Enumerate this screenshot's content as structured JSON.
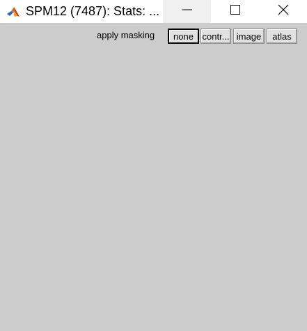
{
  "window": {
    "title": "SPM12 (7487): Stats: ...",
    "icon": "matlab-icon"
  },
  "titlebar_controls": {
    "minimize_icon": "minimize-icon",
    "maximize_icon": "maximize-icon",
    "close_icon": "close-icon"
  },
  "masking": {
    "label": "apply masking",
    "options": [
      {
        "label": "none",
        "selected": true
      },
      {
        "label": "contr...",
        "selected": false
      },
      {
        "label": "image",
        "selected": false
      },
      {
        "label": "atlas",
        "selected": false
      }
    ]
  },
  "colors": {
    "client_background": "#cccccc",
    "titlebar_background": "#ffffff",
    "button_face": "#e1e1e1"
  }
}
